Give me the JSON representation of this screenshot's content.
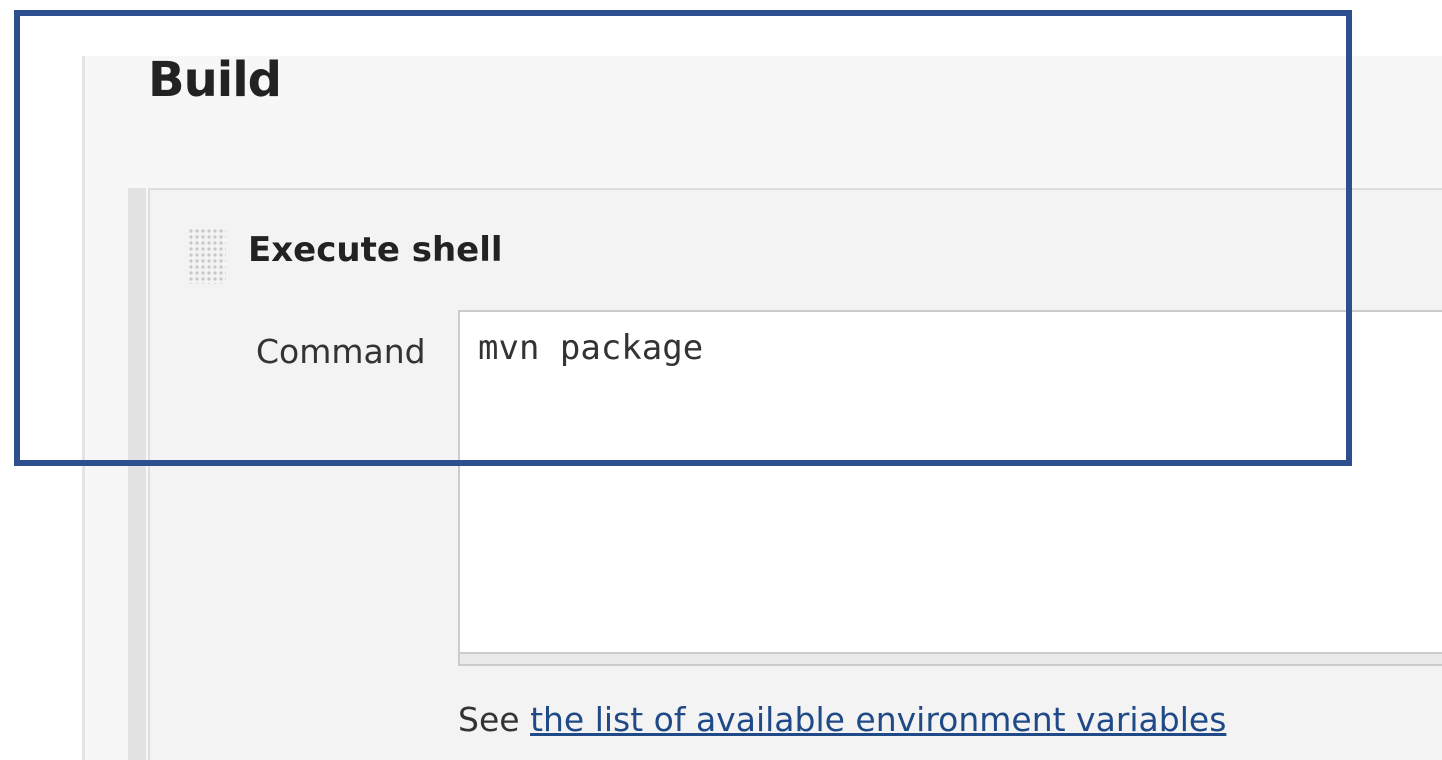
{
  "section": {
    "title": "Build"
  },
  "build_step": {
    "title": "Execute shell",
    "drag_icon": "drag-handle-icon",
    "command_label": "Command",
    "command_value": "mvn package",
    "help_prefix": "See",
    "help_link_text": "the list of available environment variables"
  },
  "colors": {
    "highlight_border": "#2e4f8f",
    "link": "#204a87"
  }
}
